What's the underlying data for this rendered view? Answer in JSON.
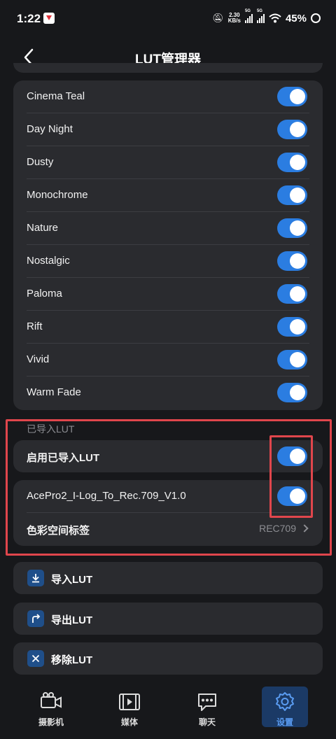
{
  "status_bar": {
    "time": "1:22",
    "speed_value": "2.30",
    "speed_unit": "KB/s",
    "signal1": "5G",
    "signal2": "5G",
    "battery": "45%"
  },
  "header": {
    "title": "LUT管理器"
  },
  "lut_list": [
    {
      "label": "Cinema Teal",
      "enabled": true
    },
    {
      "label": "Day Night",
      "enabled": true
    },
    {
      "label": "Dusty",
      "enabled": true
    },
    {
      "label": "Monochrome",
      "enabled": true
    },
    {
      "label": "Nature",
      "enabled": true
    },
    {
      "label": "Nostalgic",
      "enabled": true
    },
    {
      "label": "Paloma",
      "enabled": true
    },
    {
      "label": "Rift",
      "enabled": true
    },
    {
      "label": "Vivid",
      "enabled": true
    },
    {
      "label": "Warm Fade",
      "enabled": true
    }
  ],
  "imported": {
    "section_label": "已导入LUT",
    "enable_label": "启用已导入LUT",
    "enable_on": true,
    "file_label": "AcePro2_I-Log_To_Rec.709_V1.0",
    "file_on": true,
    "color_space_label": "色彩空间标签",
    "color_space_value": "REC709"
  },
  "actions": {
    "import_label": "导入LUT",
    "export_label": "导出LUT",
    "remove_label": "移除LUT"
  },
  "bottom_nav": {
    "camera": "摄影机",
    "media": "媒体",
    "chat": "聊天",
    "settings": "设置"
  },
  "colors": {
    "accent": "#2b7de1",
    "highlight": "#e0464c",
    "card": "#2a2b2f",
    "background": "#17181b"
  }
}
